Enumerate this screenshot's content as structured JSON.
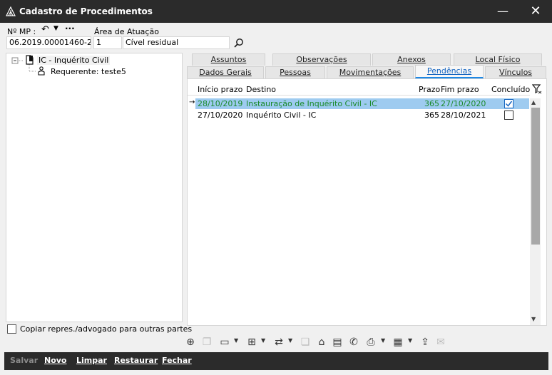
{
  "window": {
    "title": "Cadastro de Procedimentos"
  },
  "header": {
    "mp_label": "Nº MP :",
    "mp_value": "06.2019.00001460-2",
    "area_label": "Área de Atuação",
    "area_code": "1",
    "area_name": "Cível residual"
  },
  "tree": {
    "root_label": "IC - Inquérito Civil",
    "child_label": "Requerente: teste5"
  },
  "copy_option": {
    "label": "Copiar repres./advogado para outras partes",
    "checked": false
  },
  "tabs": {
    "row1": [
      "Assuntos",
      "Observações",
      "Anexos",
      "Local Físico"
    ],
    "row2": [
      "Dados Gerais",
      "Pessoas",
      "Movimentações",
      "Pendências",
      "Vínculos"
    ],
    "active": "Pendências"
  },
  "grid": {
    "columns": [
      "Início prazo",
      "Destino",
      "Prazo",
      "Fim prazo",
      "Concluído"
    ],
    "rows": [
      {
        "inicio": "28/10/2019",
        "destino": "Instauração de Inquérito Civil - IC",
        "prazo": "365",
        "fim": "27/10/2020",
        "concluido": true
      },
      {
        "inicio": "27/10/2020",
        "destino": "Inquérito Civil - IC",
        "prazo": "365",
        "fim": "28/10/2021",
        "concluido": false
      }
    ],
    "colors": {
      "selected_bg": "#9ecbf0",
      "selected_text": "#1a8a2a"
    }
  },
  "actions": {
    "salvar": "Salvar",
    "novo": "Novo",
    "limpar": "Limpar",
    "restaurar": "Restaurar",
    "fechar": "Fechar"
  },
  "icons": {
    "minimize": "minimize-icon",
    "close": "close-icon",
    "search": "search-icon",
    "filter": "filter-icon"
  }
}
